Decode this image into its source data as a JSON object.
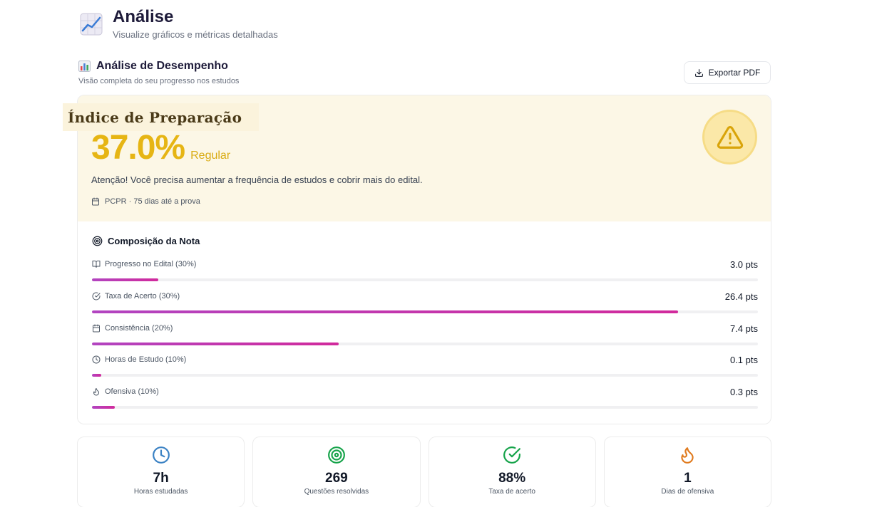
{
  "header": {
    "title": "Análise",
    "subtitle": "Visualize gráficos e métricas detalhadas"
  },
  "section": {
    "title": "Análise de Desempenho",
    "subtitle": "Visão completa do seu progresso nos estudos",
    "export_label": "Exportar PDF"
  },
  "readiness": {
    "title": "Índice de Preparação",
    "score": "37.0%",
    "rating": "Regular",
    "message": "Atenção! Você precisa aumentar a frequência de estudos e cobrir mais do edital.",
    "exam_info": "PCPR · 75 dias até a prova",
    "score_fraction": 0.37
  },
  "composition": {
    "title": "Composição da Nota",
    "items": [
      {
        "label": "Progresso no Edital (30%)",
        "points": "3.0 pts",
        "icon": "book-icon",
        "fill_fraction": 0.1
      },
      {
        "label": "Taxa de Acerto (30%)",
        "points": "26.4 pts",
        "icon": "check-circle-icon",
        "fill_fraction": 0.88
      },
      {
        "label": "Consistência (20%)",
        "points": "7.4 pts",
        "icon": "calendar-icon",
        "fill_fraction": 0.37
      },
      {
        "label": "Horas de Estudo (10%)",
        "points": "0.1 pts",
        "icon": "clock-icon",
        "fill_fraction": 0.014
      },
      {
        "label": "Ofensiva (10%)",
        "points": "0.3 pts",
        "icon": "flame-icon",
        "fill_fraction": 0.034
      }
    ]
  },
  "stats": [
    {
      "value": "7h",
      "label": "Horas estudadas",
      "icon": "clock-icon",
      "color": "#3b82c4"
    },
    {
      "value": "269",
      "label": "Questões resolvidas",
      "icon": "target-icon",
      "color": "#16a34a"
    },
    {
      "value": "88%",
      "label": "Taxa de acerto",
      "icon": "check-circle-icon",
      "color": "#16a34a"
    },
    {
      "value": "1",
      "label": "Dias de ofensiva",
      "icon": "flame-icon",
      "color": "#e07b1f"
    }
  ],
  "colors": {
    "score_accent": "#e6b514",
    "banner_background": "#fcf7e6",
    "bar_gradient_start": "#b244c0",
    "bar_gradient_end": "#d12a9c"
  }
}
